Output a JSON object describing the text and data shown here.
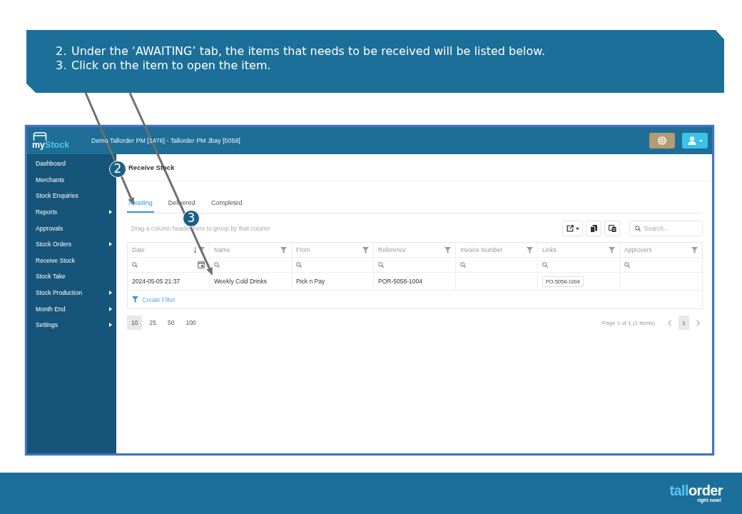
{
  "instructions": [
    {
      "number": "2.",
      "text": "Under the ‘AWAITING’ tab, the items that needs to be received will be listed below."
    },
    {
      "number": "3.",
      "text": "Click on the item to open the item."
    }
  ],
  "callouts": [
    {
      "number": "2"
    },
    {
      "number": "3"
    }
  ],
  "app": {
    "logo": {
      "lead": "my",
      "tail": "Stock"
    },
    "context": "Demo Tallorder PM [1476] - Tallorder PM Jbay [5058]",
    "sidebar": {
      "items": [
        {
          "label": "Dashboard",
          "has_submenu": false
        },
        {
          "label": "Merchants",
          "has_submenu": false
        },
        {
          "label": "Stock Enquiries",
          "has_submenu": false
        },
        {
          "label": "Reports",
          "has_submenu": true
        },
        {
          "label": "Approvals",
          "has_submenu": false
        },
        {
          "label": "Stock Orders",
          "has_submenu": true
        },
        {
          "label": "Receive Stock",
          "has_submenu": false
        },
        {
          "label": "Stock Take",
          "has_submenu": false
        },
        {
          "label": "Stock Production",
          "has_submenu": true
        },
        {
          "label": "Month End",
          "has_submenu": true
        },
        {
          "label": "Settings",
          "has_submenu": true
        }
      ]
    },
    "page_title": "Receive Stock",
    "tabs": [
      {
        "label": "Awaiting",
        "selected": true
      },
      {
        "label": "Delivered",
        "selected": false
      },
      {
        "label": "Completed",
        "selected": false
      }
    ],
    "group_panel": "Drag a column header here to group by that column",
    "search": {
      "placeholder": "Search..."
    },
    "table": {
      "columns": [
        {
          "label": "Date",
          "kind": "date",
          "sorted": true
        },
        {
          "label": "Name",
          "kind": "text",
          "sorted": false
        },
        {
          "label": "From",
          "kind": "text",
          "sorted": false
        },
        {
          "label": "Reference",
          "kind": "text",
          "sorted": false
        },
        {
          "label": "Invoice Number",
          "kind": "text",
          "sorted": false
        },
        {
          "label": "Links",
          "kind": "text",
          "sorted": false
        },
        {
          "label": "Approvers",
          "kind": "text",
          "sorted": false
        }
      ],
      "rows": [
        {
          "cells": [
            {
              "kind": "text",
              "text": "2024-05-05 21:37"
            },
            {
              "kind": "text",
              "text": "Weekly Cold Drinks"
            },
            {
              "kind": "text",
              "text": "Pick n Pay"
            },
            {
              "kind": "text",
              "text": "POR-5058-1004"
            },
            {
              "kind": "empty"
            },
            {
              "kind": "link",
              "text": "PO-5058-1004"
            },
            {
              "kind": "empty"
            }
          ]
        }
      ],
      "create_filter": "Create Filter"
    },
    "pager": {
      "page_sizes": [
        {
          "label": "10",
          "selected": true
        },
        {
          "label": "25",
          "selected": false
        },
        {
          "label": "50",
          "selected": false
        },
        {
          "label": "100",
          "selected": false
        }
      ],
      "summary": "Page 1 of 1 (1 items)",
      "pages": [
        {
          "label": "1",
          "selected": true
        }
      ]
    }
  },
  "footer": {
    "logo": {
      "accent": "tall",
      "rest": "order",
      "tagline": "right now!"
    }
  }
}
